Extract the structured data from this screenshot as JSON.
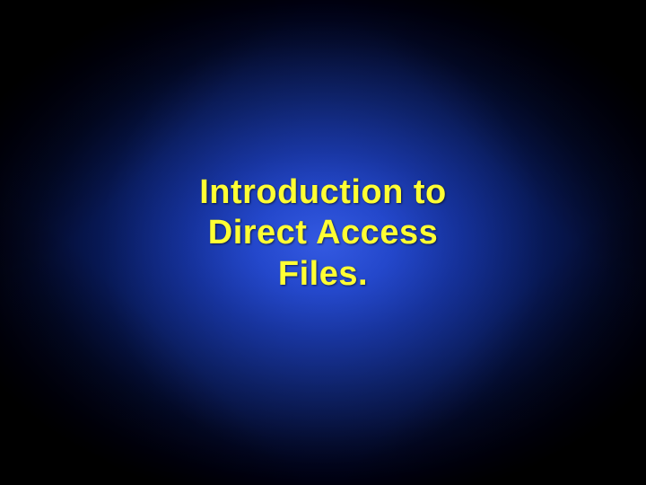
{
  "slide": {
    "title": "Introduction to\nDirect Access\nFiles."
  },
  "colors": {
    "title_color": "#ffff33",
    "bg_center": "#2a4fd8",
    "bg_outer": "#000000"
  }
}
